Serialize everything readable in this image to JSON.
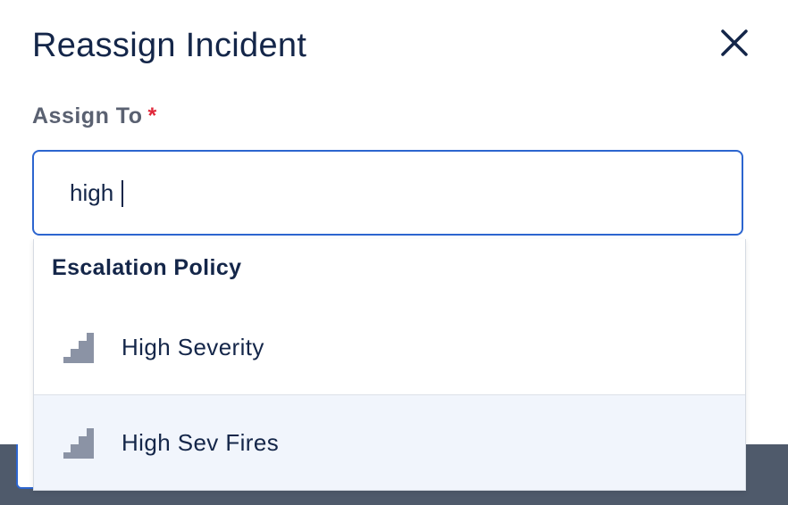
{
  "modal": {
    "title": "Reassign Incident",
    "close_icon": "close-icon"
  },
  "assign_field": {
    "label": "Assign To",
    "required_marker": "*",
    "value": "high"
  },
  "dropdown": {
    "group_header": "Escalation Policy",
    "options": [
      {
        "label": "High Severity",
        "icon": "escalation-policy-icon",
        "highlighted": false
      },
      {
        "label": "High Sev Fires",
        "icon": "escalation-policy-icon",
        "highlighted": true
      }
    ]
  },
  "colors": {
    "text_primary": "#142649",
    "label_gray": "#5a6171",
    "focus_border": "#2c65cf",
    "required_red": "#e0283a",
    "highlight_bg": "#f1f5fc",
    "icon_gray": "#8b93a5"
  }
}
